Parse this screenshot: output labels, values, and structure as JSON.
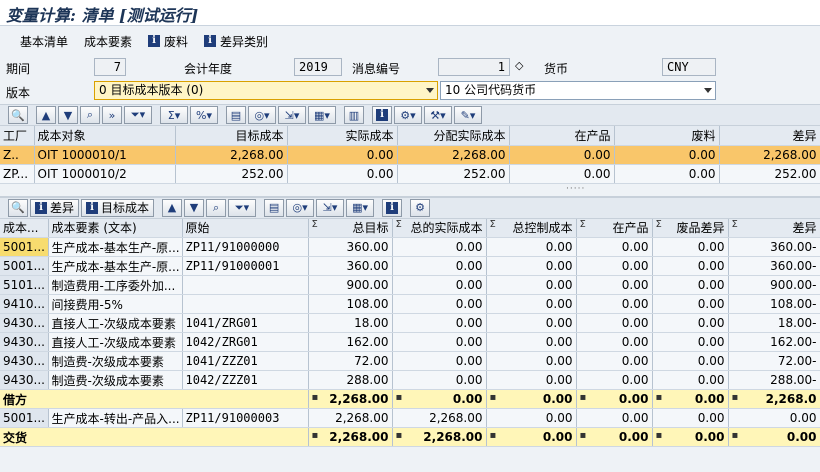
{
  "window": {
    "title": "变量计算: 清单 [测试运行]"
  },
  "appbar": {
    "items": [
      "基本清单",
      "成本要素",
      "废料",
      "差异类别"
    ]
  },
  "form": {
    "period_label": "期间",
    "period_value": "7",
    "year_label": "会计年度",
    "year_value": "2019",
    "msg_label": "消息编号",
    "msg_value": "1",
    "currency_label": "货币",
    "currency_value": "CNY",
    "version_label": "版本",
    "version_value": "0 目标成本版本 (0)",
    "currency_type_value": "10 公司代码货币"
  },
  "top_table": {
    "headers": [
      "工厂",
      "成本对象",
      "目标成本",
      "实际成本",
      "分配实际成本",
      "在产品",
      "废料",
      "差异"
    ],
    "rows": [
      [
        "Z..",
        "OIT 1000010/1",
        "2,268.00",
        "0.00",
        "2,268.00",
        "0.00",
        "0.00",
        "2,268.00"
      ],
      [
        "ZP...",
        "OIT 1000010/2",
        "252.00",
        "0.00",
        "252.00",
        "0.00",
        "0.00",
        "252.00"
      ]
    ]
  },
  "bottom_toolbar": {
    "variance_label": "差异",
    "target_cost_label": "目标成本"
  },
  "bottom_table": {
    "headers": [
      "成本...",
      "成本要素 (文本)",
      "原始",
      "总目标",
      "总的实际成本",
      "总控制成本",
      "在产品",
      "废品差异",
      "差异"
    ],
    "rows": [
      [
        "5001...",
        "生产成本-基本生产-原...",
        "ZP11/91000000",
        "360.00",
        "0.00",
        "0.00",
        "0.00",
        "0.00",
        "360.00-"
      ],
      [
        "5001...",
        "生产成本-基本生产-原...",
        "ZP11/91000001",
        "360.00",
        "0.00",
        "0.00",
        "0.00",
        "0.00",
        "360.00-"
      ],
      [
        "5101...",
        "制造费用-工序委外加...",
        "",
        "900.00",
        "0.00",
        "0.00",
        "0.00",
        "0.00",
        "900.00-"
      ],
      [
        "9410...",
        "间接费用-5%",
        "",
        "108.00",
        "0.00",
        "0.00",
        "0.00",
        "0.00",
        "108.00-"
      ],
      [
        "9430...",
        "直接人工-次级成本要素",
        "1041/ZRG01",
        "18.00",
        "0.00",
        "0.00",
        "0.00",
        "0.00",
        "18.00-"
      ],
      [
        "9430...",
        "直接人工-次级成本要素",
        "1042/ZRG01",
        "162.00",
        "0.00",
        "0.00",
        "0.00",
        "0.00",
        "162.00-"
      ],
      [
        "9430...",
        "制造费-次级成本要素",
        "1041/ZZZ01",
        "72.00",
        "0.00",
        "0.00",
        "0.00",
        "0.00",
        "72.00-"
      ],
      [
        "9430...",
        "制造费-次级成本要素",
        "1042/ZZZ01",
        "288.00",
        "0.00",
        "0.00",
        "0.00",
        "0.00",
        "288.00-"
      ]
    ],
    "debit": {
      "label": "借方",
      "values": [
        "2,268.00",
        "0.00",
        "0.00",
        "0.00",
        "0.00",
        "2,268.0"
      ]
    },
    "credit_row": [
      "5001...",
      "生产成本-转出-产品入...",
      "ZP11/91000003",
      "2,268.00",
      "2,268.00",
      "0.00",
      "0.00",
      "0.00",
      "0.00"
    ],
    "delivery": {
      "label": "交货",
      "values": [
        "2,268.00",
        "2,268.00",
        "0.00",
        "0.00",
        "0.00",
        "0.00"
      ]
    }
  }
}
